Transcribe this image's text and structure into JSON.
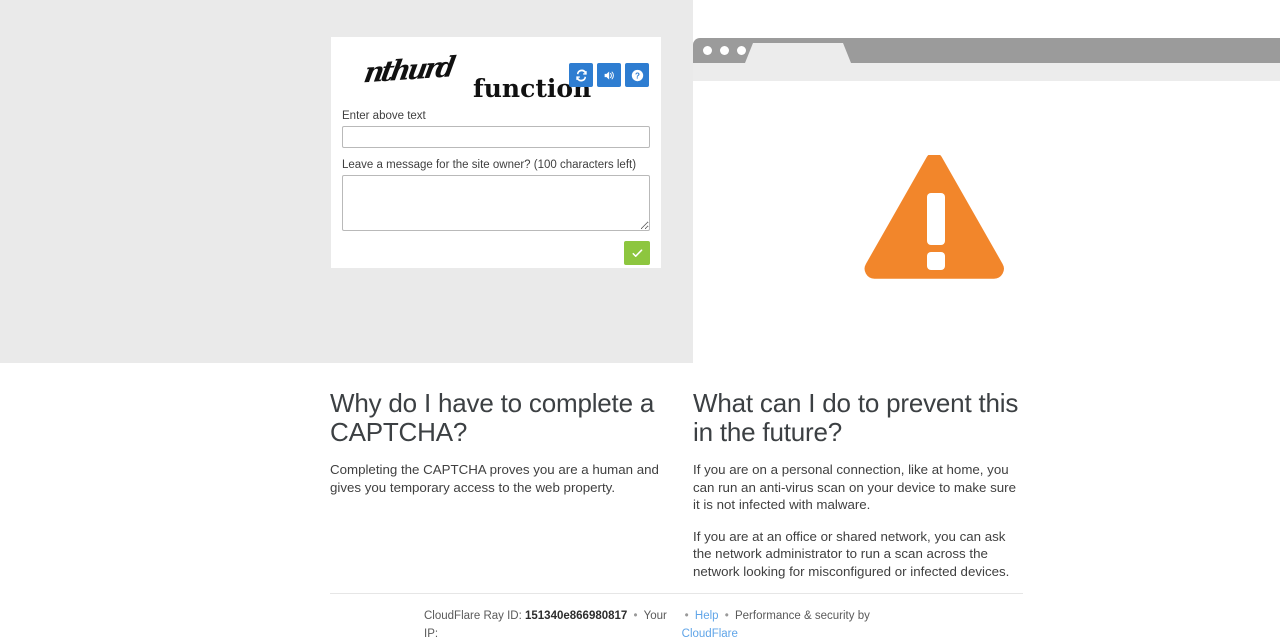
{
  "captcha": {
    "image_text_distorted": "nthurd",
    "image_text_plain": "function",
    "refresh_icon": "refresh-icon",
    "audio_icon": "speaker-icon",
    "help_icon": "question-mark-icon",
    "answer_label": "Enter above text",
    "answer_value": "",
    "answer_placeholder": "",
    "message_label": "Leave a message for the site owner? (100 characters left)",
    "message_value": "",
    "message_placeholder": "",
    "submit_icon": "checkmark-icon",
    "submit_color": "#8dc63f",
    "button_color": "#2e7dd1"
  },
  "browser_mock": {
    "dots_count": 3,
    "warning_icon": "warning-triangle-icon",
    "warning_color": "#f2862b"
  },
  "info": {
    "left": {
      "heading": "Why do I have to complete a CAPTCHA?",
      "paragraphs": [
        "Completing the CAPTCHA proves you are a human and gives you temporary access to the web property."
      ]
    },
    "right": {
      "heading": "What can I do to prevent this in the future?",
      "paragraphs": [
        "If you are on a personal connection, like at home, you can run an anti-virus scan on your device to make sure it is not infected with malware.",
        "If you are at an office or shared network, you can ask the network administrator to run a scan across the network looking for misconfigured or infected devices."
      ]
    }
  },
  "footer": {
    "ray_label": "CloudFlare Ray ID:",
    "ray_id": "151340e866980817",
    "separator": "•",
    "your_ip_label": "Your IP:",
    "your_ip_value": "",
    "help_link": "Help",
    "performance_text": "Performance & security by",
    "brand_link": "CloudFlare",
    "link_color": "#60a5e8"
  }
}
